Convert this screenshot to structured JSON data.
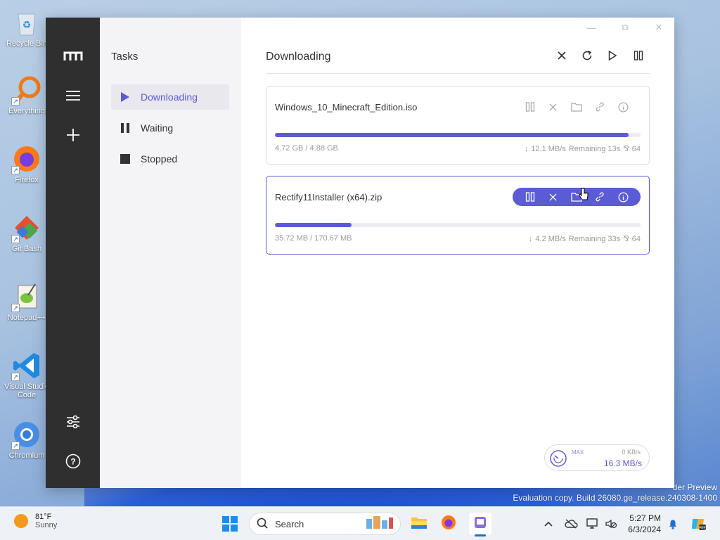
{
  "desktop": {
    "icons": [
      {
        "label": "Recycle Bin",
        "icon": "recycle-bin-icon"
      },
      {
        "label": "Everything",
        "icon": "everything-search-icon"
      },
      {
        "label": "Firefox",
        "icon": "firefox-icon"
      },
      {
        "label": "Git Bash",
        "icon": "git-icon"
      },
      {
        "label": "Notepad++",
        "icon": "notepadpp-icon"
      },
      {
        "label": "Visual Studio Code",
        "label_line1": "Visual Studio",
        "label_line2": "Code",
        "icon": "vscode-icon"
      },
      {
        "label": "Chromium",
        "icon": "chromium-icon"
      }
    ],
    "watermark_line1": "Windows 11 Pro Insider Preview",
    "watermark_visible1": "der Preview",
    "watermark_line2": "Evaluation copy. Build 26080.ge_release.240308-1400"
  },
  "window": {
    "controls": {
      "minimize": "—",
      "restore": "⧉",
      "close": "✕"
    },
    "sidebar": {
      "title": "Tasks",
      "items": [
        {
          "label": "Downloading",
          "icon": "play-icon",
          "active": true
        },
        {
          "label": "Waiting",
          "icon": "pause-icon",
          "active": false
        },
        {
          "label": "Stopped",
          "icon": "stop-icon",
          "active": false
        }
      ]
    },
    "main": {
      "title": "Downloading",
      "toolbar": [
        "close-icon",
        "refresh-icon",
        "play-icon",
        "pause-icon"
      ],
      "tasks": [
        {
          "name": "Windows_10_Minecraft_Edition.iso",
          "size": "4.72 GB / 4.88 GB",
          "speed": "12.1 MB/s",
          "remaining": "Remaining 13s",
          "connections": "64",
          "progress": 0.967
        },
        {
          "name": "Rectify11Installer (x64).zip",
          "size": "35.72 MB / 170.67 MB",
          "speed": "4.2 MB/s",
          "remaining": "Remaining 33s",
          "connections": "64",
          "progress": 0.209
        }
      ]
    },
    "speedometer": {
      "max_label": "MAX",
      "upload": "0 KB/s",
      "download": "16.3 MB/s"
    }
  },
  "taskbar": {
    "weather": {
      "temp": "81°F",
      "condition": "Sunny"
    },
    "search_placeholder": "Search",
    "time": "5:27 PM",
    "date": "6/3/2024",
    "accent": "#5b5bd6"
  }
}
